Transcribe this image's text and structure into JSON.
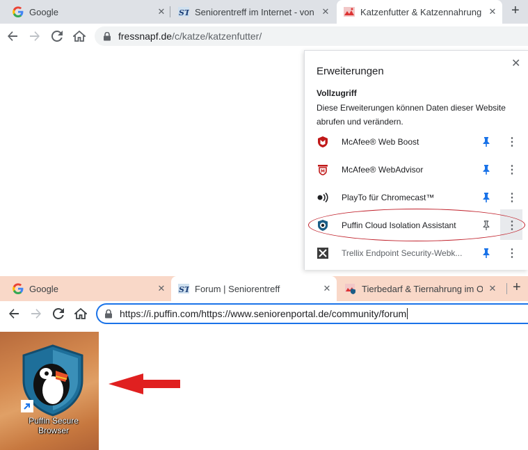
{
  "top_browser": {
    "tabs": [
      {
        "title": "Google",
        "icon": "google-icon",
        "close": "✕"
      },
      {
        "title": "Seniorentreff im Internet - von ur",
        "icon": "seniorentreff-st-icon",
        "close": "✕"
      },
      {
        "title": "Katzenfutter & Katzennahrung o",
        "icon": "fressnapf-icon",
        "close": "✕"
      }
    ],
    "new_tab": "+",
    "url": {
      "host": "fressnapf.de",
      "path": "/c/katze/katzenfutter/"
    }
  },
  "extensions_popup": {
    "title": "Erweiterungen",
    "close": "✕",
    "section_title": "Vollzugriff",
    "section_desc": "Diese Erweiterungen können Daten dieser Website abrufen und verändern.",
    "items": [
      {
        "name": "McAfee® Web Boost",
        "icon": "mcafee-shield-icon",
        "pinned": true
      },
      {
        "name": "McAfee® WebAdvisor",
        "icon": "mcafee-webadvisor-icon",
        "pinned": true
      },
      {
        "name": "PlayTo für Chromecast™",
        "icon": "playto-cast-icon",
        "pinned": true
      },
      {
        "name": "Puffin Cloud Isolation Assistant",
        "icon": "puffin-shield-icon",
        "pinned": false
      },
      {
        "name": "Trellix Endpoint Security-Webk...",
        "icon": "trellix-x-icon",
        "pinned": true
      }
    ],
    "more": "⋮"
  },
  "bottom_browser": {
    "tabs": [
      {
        "title": "Google",
        "icon": "google-icon",
        "close": "✕"
      },
      {
        "title": "Forum | Seniorentreff",
        "icon": "seniorentreff-st-icon",
        "close": "✕"
      },
      {
        "title": "Tierbedarf & Tiernahrung im Onl",
        "icon": "fressnapf-puffin-icon",
        "close": "✕"
      }
    ],
    "new_tab": "+",
    "url": "https://i.puffin.com/https://www.seniorenportal.de/community/forum"
  },
  "desktop_icon": {
    "label_line1": "Puffin Secure",
    "label_line2": "Browser"
  },
  "colors": {
    "highlight": "#c0202a",
    "arrow": "#e02020",
    "accent": "#1a73e8",
    "tabbar_bottom": "#f9d8c8"
  }
}
